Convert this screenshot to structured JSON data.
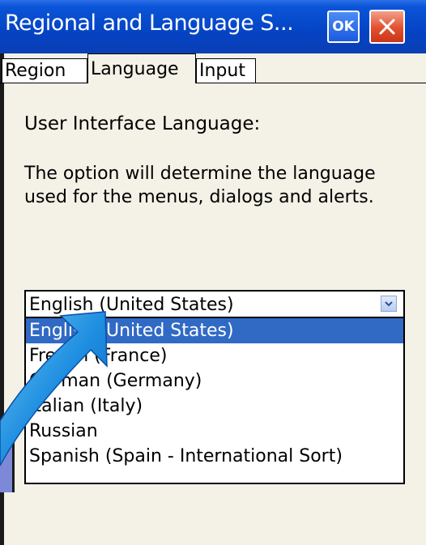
{
  "window": {
    "title": "Regional and Language S...",
    "ok_label": "OK"
  },
  "tabs": [
    {
      "label": "Region"
    },
    {
      "label": "Language"
    },
    {
      "label": "Input"
    }
  ],
  "section": {
    "heading": "User Interface Language:",
    "description": "The option will determine the language used for the menus, dialogs and alerts."
  },
  "language_combo": {
    "selected": "English (United States)",
    "options": [
      "English (United States)",
      "French (France)",
      "German (Germany)",
      "Italian (Italy)",
      "Russian",
      "Spanish (Spain - International Sort)"
    ]
  },
  "colors": {
    "titlebar": "#0543c4",
    "selection": "#316ac5",
    "arrow": "#1e6fd9"
  },
  "icons": {
    "close": "close-icon",
    "dropdown": "chevron-down-icon",
    "overlay": "curved-arrow-icon"
  }
}
